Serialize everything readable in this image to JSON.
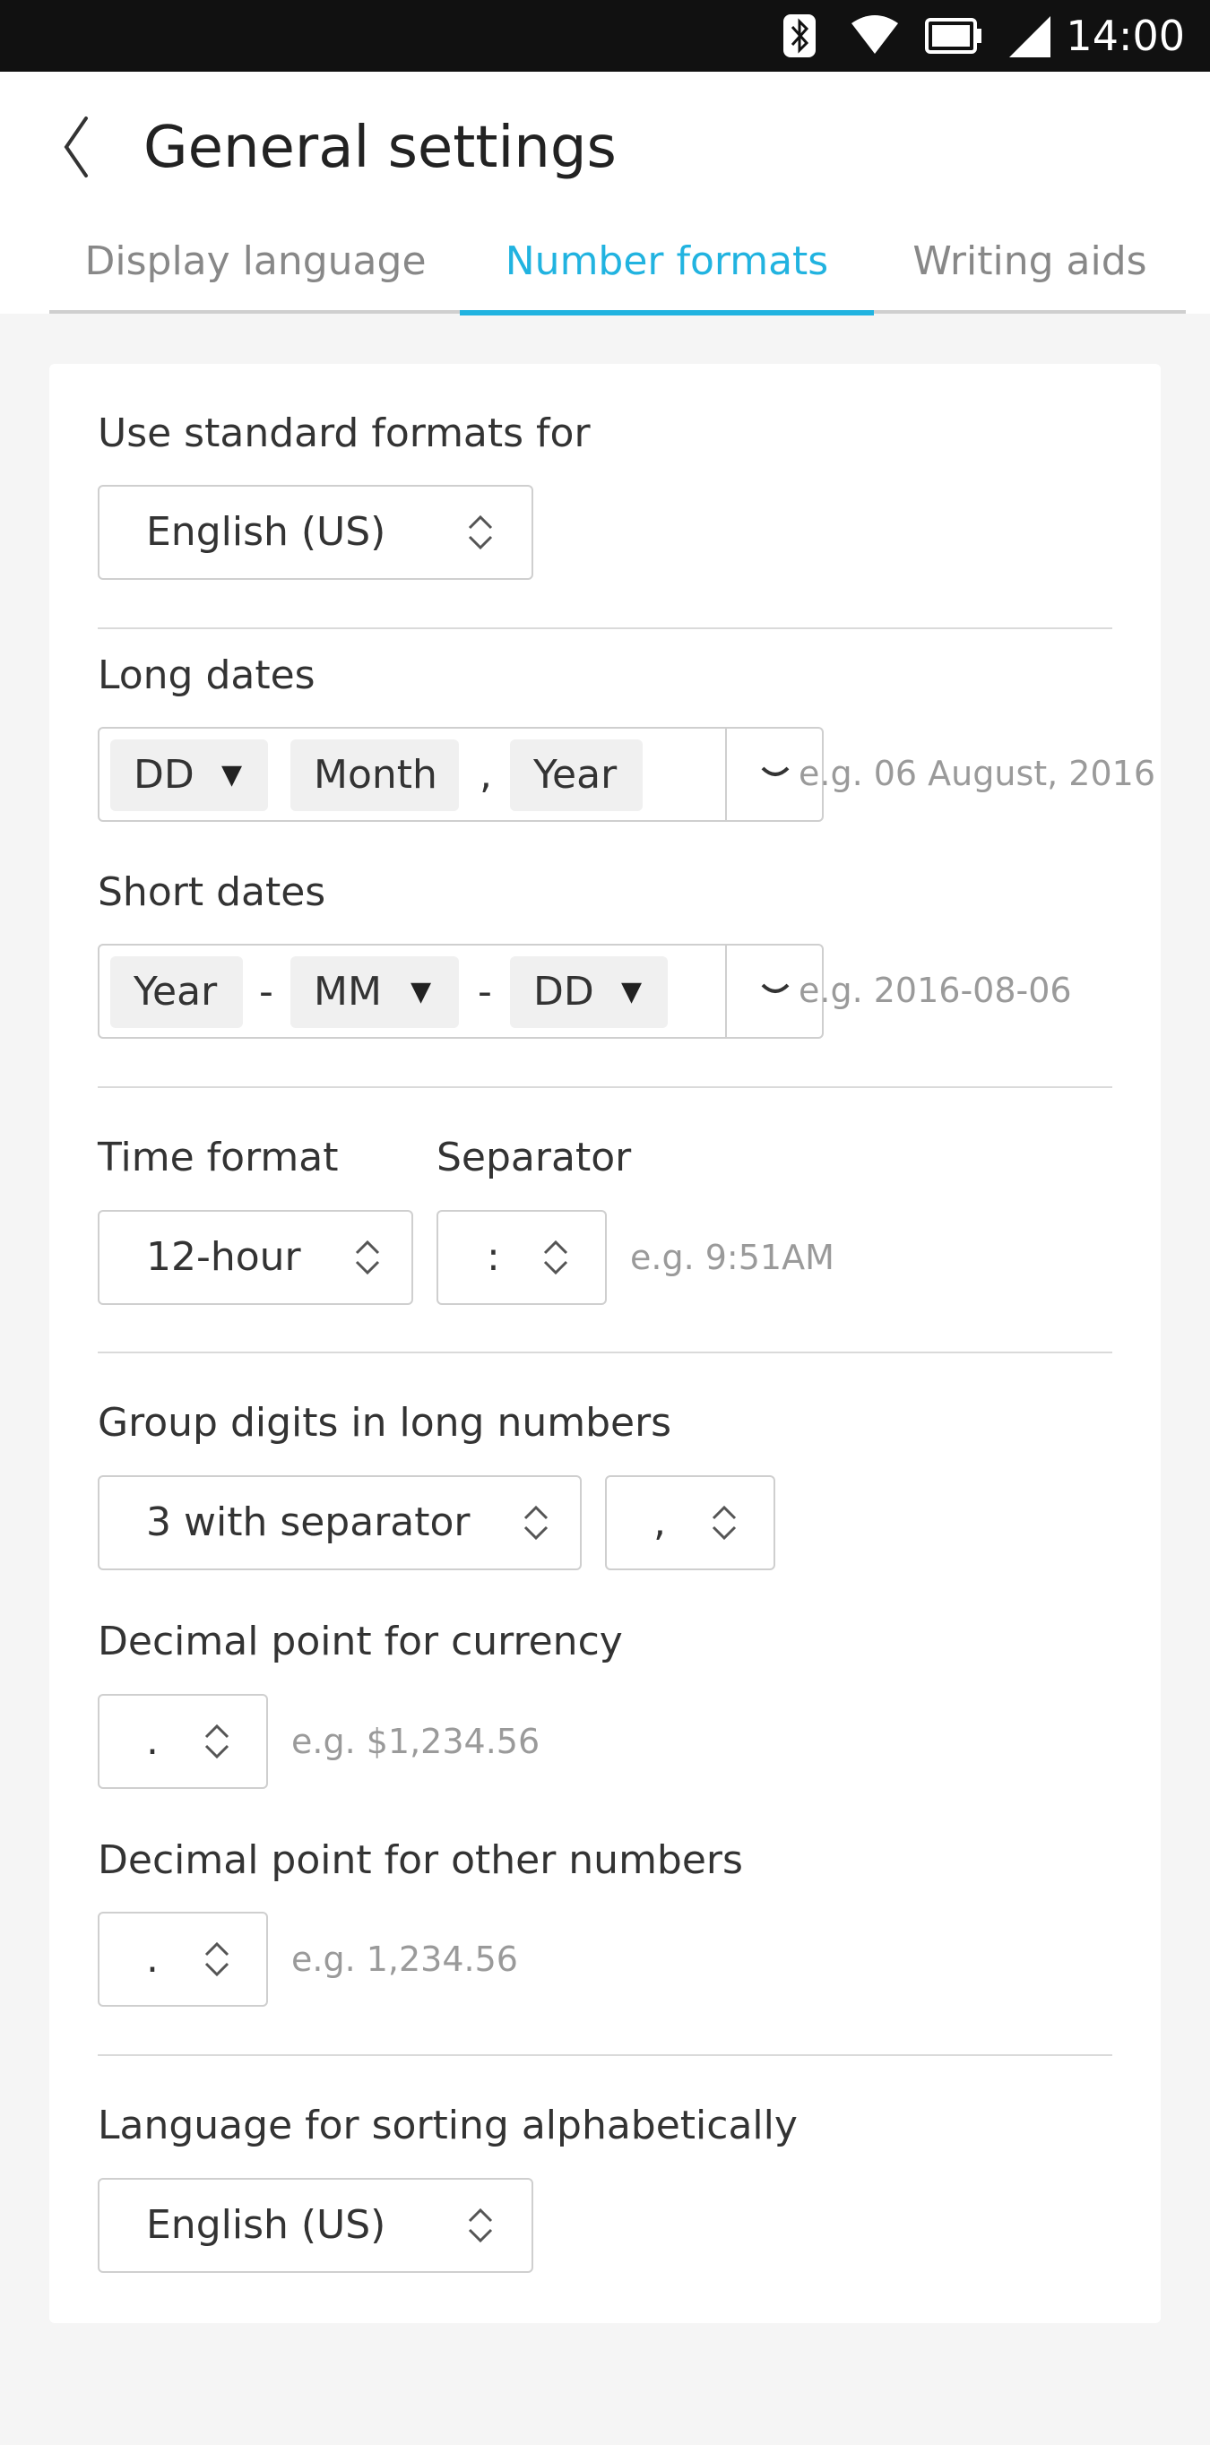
{
  "status_bar": {
    "time": "14:00",
    "icons": [
      "bluetooth-icon",
      "wifi-icon",
      "battery-icon",
      "signal-icon"
    ]
  },
  "header": {
    "title": "General settings"
  },
  "tabs": [
    {
      "label": "Display language",
      "active": false
    },
    {
      "label": "Number formats",
      "active": true
    },
    {
      "label": "Writing aids",
      "active": false
    }
  ],
  "accent_color": "#21b3e0",
  "standard_formats": {
    "label": "Use standard formats for",
    "value": "English (US)"
  },
  "long_dates": {
    "label": "Long dates",
    "day": "DD",
    "month": "Month",
    "separator": ",",
    "year": "Year",
    "example": "e.g. 06 August, 2016"
  },
  "short_dates": {
    "label": "Short dates",
    "year": "Year",
    "sep1": "-",
    "month": "MM",
    "sep2": "-",
    "day": "DD",
    "example": "e.g. 2016-08-06"
  },
  "time": {
    "format_label": "Time format",
    "format_value": "12-hour",
    "separator_label": "Separator",
    "separator_value": ":",
    "example": "e.g. 9:51AM"
  },
  "group_digits": {
    "label": "Group digits in long numbers",
    "value": "3 with separator",
    "separator": ","
  },
  "currency_decimal": {
    "label": "Decimal point for currency",
    "value": ".",
    "example": "e.g. $1,234.56"
  },
  "other_decimal": {
    "label": "Decimal point for other numbers",
    "value": ".",
    "example": "e.g. 1,234.56"
  },
  "sorting": {
    "label": "Language for sorting alphabetically",
    "value": "English (US)"
  }
}
